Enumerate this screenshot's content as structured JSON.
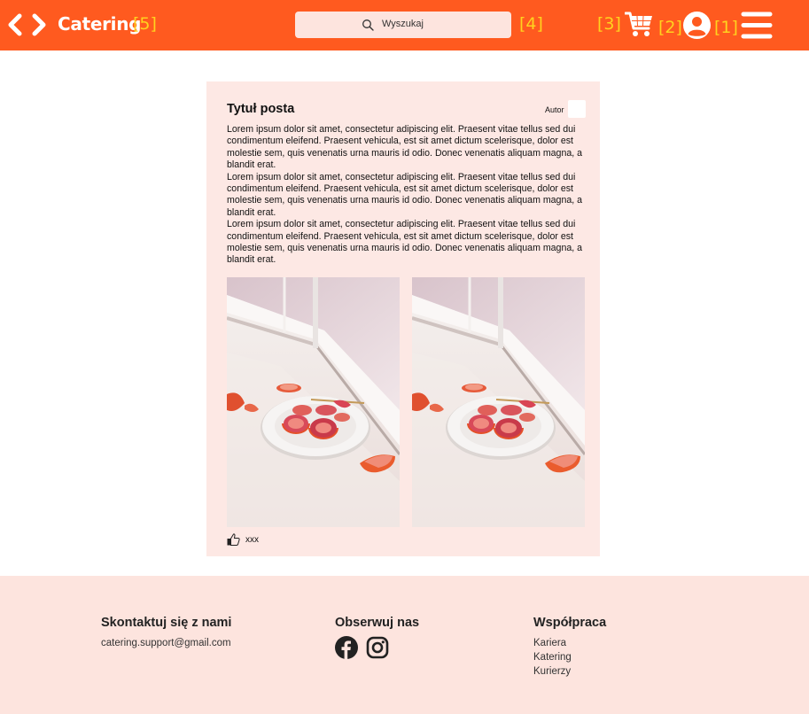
{
  "header": {
    "brand": "Catering",
    "search_placeholder": "Wyszukaj",
    "markers": [
      "[5]",
      "[4]",
      "[3]",
      "[2]",
      "[1]"
    ],
    "icons": [
      "back-arrow-icon",
      "forward-arrow-icon",
      "search-icon",
      "cart-icon",
      "user-icon",
      "menu-icon"
    ],
    "accent_color": "#ff5a1f",
    "marker_color": "#ffd21f"
  },
  "post": {
    "title": "Tytuł posta",
    "author_label": "Autor",
    "paragraphs": [
      "Lorem ipsum dolor sit amet, consectetur adipiscing elit. Praesent vitae tellus sed dui condimentum eleifend. Praesent vehicula, est sit amet dictum scelerisque, dolor est molestie sem, quis venenatis urna mauris id odio. Donec venenatis aliquam magna, a blandit erat.",
      "Lorem ipsum dolor sit amet, consectetur adipiscing elit. Praesent vitae tellus sed dui condimentum eleifend. Praesent vehicula, est sit amet dictum scelerisque, dolor est molestie sem, quis venenatis urna mauris id odio. Donec venenatis aliquam magna, a blandit erat.",
      "Lorem ipsum dolor sit amet, consectetur adipiscing elit. Praesent vitae tellus sed dui condimentum eleifend. Praesent vehicula, est sit amet dictum scelerisque, dolor est molestie sem, quis venenatis urna mauris id odio. Donec venenatis aliquam magna, a blandit erat."
    ],
    "like_count": "xxx",
    "background_color": "#fde8e4"
  },
  "footer": {
    "contact": {
      "title": "Skontaktuj się z nami",
      "email": "catering.support@gmail.com"
    },
    "follow": {
      "title": "Obserwuj nas",
      "icons": [
        "facebook-icon",
        "instagram-icon"
      ]
    },
    "cooperation": {
      "title": "Współpraca",
      "links": [
        "Kariera",
        "Katering",
        "Kurierzy"
      ]
    },
    "background_color": "#fde4de"
  }
}
